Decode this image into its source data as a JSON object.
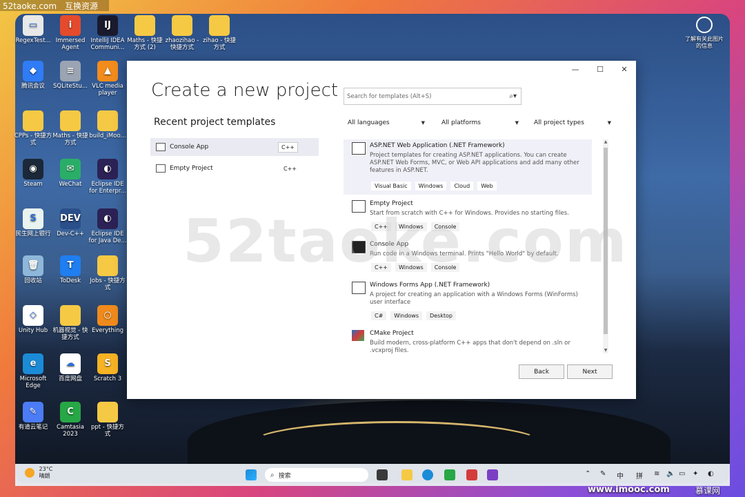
{
  "watermark": {
    "top_left": "52taoke.com",
    "top_left_2": "互换资源",
    "center": "52taoke.com",
    "bottom": "www.imooc.com",
    "bottom_2": "慕课网"
  },
  "corner_note": "了解有关此图片的信息",
  "desktop_icons": [
    {
      "label": "RegexTest...",
      "color": "#e8e8e8",
      "glyph": "▭"
    },
    {
      "label": "Immersed Agent",
      "color": "#e44b2c",
      "glyph": "i"
    },
    {
      "label": "IntelliJ IDEA Communi...",
      "color": "#1a1a2e",
      "glyph": "IJ"
    },
    {
      "label": "Maths - 快捷方式 (2)",
      "color": "#f6c945",
      "glyph": ""
    },
    {
      "label": "zhaozihao - 快捷方式",
      "color": "#f6c945",
      "glyph": ""
    },
    {
      "label": "zihao - 快捷方式",
      "color": "#f6c945",
      "glyph": ""
    },
    {
      "label": "腾讯会议",
      "color": "#2f7cf6",
      "glyph": "◆"
    },
    {
      "label": "SQLiteStu...",
      "color": "#9aa4b2",
      "glyph": "≡"
    },
    {
      "label": "VLC media player",
      "color": "#f28c1c",
      "glyph": "▲"
    },
    {
      "label": "CPPs - 快捷方式",
      "color": "#f6c945",
      "glyph": ""
    },
    {
      "label": "Maths - 快捷方式",
      "color": "#f6c945",
      "glyph": ""
    },
    {
      "label": "build_iMoo...",
      "color": "#f6c945",
      "glyph": ""
    },
    {
      "label": "Steam",
      "color": "#1b2838",
      "glyph": "◉"
    },
    {
      "label": "WeChat",
      "color": "#2aae67",
      "glyph": "✉"
    },
    {
      "label": "Eclipse IDE for Enterpr...",
      "color": "#2c2255",
      "glyph": "◐"
    },
    {
      "label": "民生网上银行",
      "color": "#e9f3f0",
      "glyph": "S"
    },
    {
      "label": "Dev-C++",
      "color": "#2a4f8a",
      "glyph": "DEV"
    },
    {
      "label": "Eclipse IDE for Java De...",
      "color": "#2c2255",
      "glyph": "◐"
    },
    {
      "label": "回收站",
      "color": "#8fb7d9",
      "glyph": "🗑"
    },
    {
      "label": "ToDesk",
      "color": "#1f7ef0",
      "glyph": "T"
    },
    {
      "label": "Jobs - 快捷方式",
      "color": "#f6c945",
      "glyph": ""
    },
    {
      "label": "Unity Hub",
      "color": "#ffffff",
      "glyph": "◇"
    },
    {
      "label": "机器视觉 - 快捷方式",
      "color": "#f6c945",
      "glyph": ""
    },
    {
      "label": "Everything",
      "color": "#f08a1c",
      "glyph": "○"
    },
    {
      "label": "Microsoft Edge",
      "color": "#1b8bd8",
      "glyph": "e"
    },
    {
      "label": "百度网盘",
      "color": "#ffffff",
      "glyph": "☁"
    },
    {
      "label": "Scratch 3",
      "color": "#f6b324",
      "glyph": "S"
    },
    {
      "label": "有道云笔记",
      "color": "#4b7cf5",
      "glyph": "✎"
    },
    {
      "label": "Camtasia 2023",
      "color": "#27a745",
      "glyph": "C"
    },
    {
      "label": "ppt - 快捷方式",
      "color": "#f6c945",
      "glyph": ""
    }
  ],
  "dialog": {
    "title": "Create a new project",
    "window_buttons": {
      "minimize": "—",
      "maximize": "☐",
      "close": "✕"
    },
    "recent_heading": "Recent project templates",
    "recent": [
      {
        "label": "Console App",
        "lang": "C++"
      },
      {
        "label": "Empty Project",
        "lang": "C++"
      }
    ],
    "search_placeholder": "Search for templates (Alt+S)",
    "filters": {
      "language": "All languages",
      "platform": "All platforms",
      "project_type": "All project types"
    },
    "templates": [
      {
        "name": "ASP.NET Web Application (.NET Framework)",
        "description": "Project templates for creating ASP.NET applications. You can create ASP.NET Web Forms, MVC, or Web API applications and add many other features in ASP.NET.",
        "tags": [
          "Visual Basic",
          "Windows",
          "Cloud",
          "Web"
        ]
      },
      {
        "name": "Empty Project",
        "description": "Start from scratch with C++ for Windows. Provides no starting files.",
        "tags": [
          "C++",
          "Windows",
          "Console"
        ]
      },
      {
        "name": "Console App",
        "description": "Run code in a Windows terminal. Prints \"Hello World\" by default.",
        "tags": [
          "C++",
          "Windows",
          "Console"
        ]
      },
      {
        "name": "Windows Forms App (.NET Framework)",
        "description": "A project for creating an application with a Windows Forms (WinForms) user interface",
        "tags": [
          "C#",
          "Windows",
          "Desktop"
        ]
      },
      {
        "name": "CMake Project",
        "description": "Build modern, cross-platform C++ apps that don't depend on .sln or .vcxproj files."
      }
    ],
    "back_label": "Back",
    "next_label": "Next"
  },
  "taskbar": {
    "weather_temp": "23°C",
    "weather_text": "晴朗",
    "search_label": "搜索",
    "tray_ime_1": "中",
    "tray_ime_2": "拼"
  }
}
